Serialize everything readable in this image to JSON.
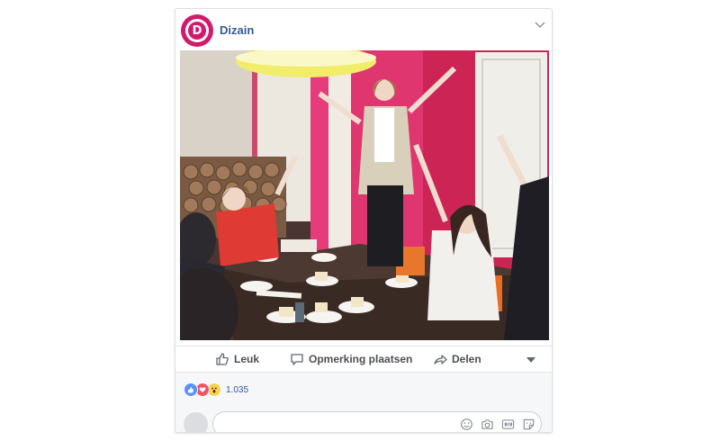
{
  "post": {
    "page_name": "Dizain",
    "logo_letter": "D",
    "photo_alt": ""
  },
  "actions": {
    "like": "Leuk",
    "comment": "Opmerking plaatsen",
    "share": "Delen"
  },
  "reactions": {
    "count": "1.035",
    "types": [
      "like-icon",
      "love-icon",
      "wow-icon"
    ]
  },
  "comment": {
    "value": "",
    "placeholder": ""
  },
  "colors": {
    "brand": "#d1196d",
    "link": "#365899",
    "action_text": "#4b4f56",
    "like": "#5890ff",
    "love": "#f25268",
    "wow": "#fcd050"
  }
}
